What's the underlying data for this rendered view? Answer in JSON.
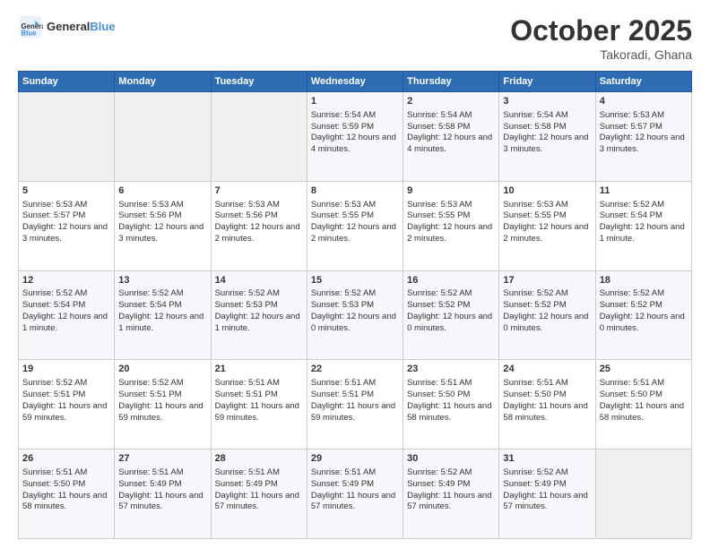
{
  "header": {
    "logo_text_general": "General",
    "logo_text_blue": "Blue",
    "month": "October 2025",
    "location": "Takoradi, Ghana"
  },
  "weekdays": [
    "Sunday",
    "Monday",
    "Tuesday",
    "Wednesday",
    "Thursday",
    "Friday",
    "Saturday"
  ],
  "weeks": [
    [
      {
        "day": "",
        "empty": true
      },
      {
        "day": "",
        "empty": true
      },
      {
        "day": "",
        "empty": true
      },
      {
        "day": "1",
        "sunrise": "Sunrise: 5:54 AM",
        "sunset": "Sunset: 5:59 PM",
        "daylight": "Daylight: 12 hours and 4 minutes."
      },
      {
        "day": "2",
        "sunrise": "Sunrise: 5:54 AM",
        "sunset": "Sunset: 5:58 PM",
        "daylight": "Daylight: 12 hours and 4 minutes."
      },
      {
        "day": "3",
        "sunrise": "Sunrise: 5:54 AM",
        "sunset": "Sunset: 5:58 PM",
        "daylight": "Daylight: 12 hours and 3 minutes."
      },
      {
        "day": "4",
        "sunrise": "Sunrise: 5:53 AM",
        "sunset": "Sunset: 5:57 PM",
        "daylight": "Daylight: 12 hours and 3 minutes."
      }
    ],
    [
      {
        "day": "5",
        "sunrise": "Sunrise: 5:53 AM",
        "sunset": "Sunset: 5:57 PM",
        "daylight": "Daylight: 12 hours and 3 minutes."
      },
      {
        "day": "6",
        "sunrise": "Sunrise: 5:53 AM",
        "sunset": "Sunset: 5:56 PM",
        "daylight": "Daylight: 12 hours and 3 minutes."
      },
      {
        "day": "7",
        "sunrise": "Sunrise: 5:53 AM",
        "sunset": "Sunset: 5:56 PM",
        "daylight": "Daylight: 12 hours and 2 minutes."
      },
      {
        "day": "8",
        "sunrise": "Sunrise: 5:53 AM",
        "sunset": "Sunset: 5:55 PM",
        "daylight": "Daylight: 12 hours and 2 minutes."
      },
      {
        "day": "9",
        "sunrise": "Sunrise: 5:53 AM",
        "sunset": "Sunset: 5:55 PM",
        "daylight": "Daylight: 12 hours and 2 minutes."
      },
      {
        "day": "10",
        "sunrise": "Sunrise: 5:53 AM",
        "sunset": "Sunset: 5:55 PM",
        "daylight": "Daylight: 12 hours and 2 minutes."
      },
      {
        "day": "11",
        "sunrise": "Sunrise: 5:52 AM",
        "sunset": "Sunset: 5:54 PM",
        "daylight": "Daylight: 12 hours and 1 minute."
      }
    ],
    [
      {
        "day": "12",
        "sunrise": "Sunrise: 5:52 AM",
        "sunset": "Sunset: 5:54 PM",
        "daylight": "Daylight: 12 hours and 1 minute."
      },
      {
        "day": "13",
        "sunrise": "Sunrise: 5:52 AM",
        "sunset": "Sunset: 5:54 PM",
        "daylight": "Daylight: 12 hours and 1 minute."
      },
      {
        "day": "14",
        "sunrise": "Sunrise: 5:52 AM",
        "sunset": "Sunset: 5:53 PM",
        "daylight": "Daylight: 12 hours and 1 minute."
      },
      {
        "day": "15",
        "sunrise": "Sunrise: 5:52 AM",
        "sunset": "Sunset: 5:53 PM",
        "daylight": "Daylight: 12 hours and 0 minutes."
      },
      {
        "day": "16",
        "sunrise": "Sunrise: 5:52 AM",
        "sunset": "Sunset: 5:52 PM",
        "daylight": "Daylight: 12 hours and 0 minutes."
      },
      {
        "day": "17",
        "sunrise": "Sunrise: 5:52 AM",
        "sunset": "Sunset: 5:52 PM",
        "daylight": "Daylight: 12 hours and 0 minutes."
      },
      {
        "day": "18",
        "sunrise": "Sunrise: 5:52 AM",
        "sunset": "Sunset: 5:52 PM",
        "daylight": "Daylight: 12 hours and 0 minutes."
      }
    ],
    [
      {
        "day": "19",
        "sunrise": "Sunrise: 5:52 AM",
        "sunset": "Sunset: 5:51 PM",
        "daylight": "Daylight: 11 hours and 59 minutes."
      },
      {
        "day": "20",
        "sunrise": "Sunrise: 5:52 AM",
        "sunset": "Sunset: 5:51 PM",
        "daylight": "Daylight: 11 hours and 59 minutes."
      },
      {
        "day": "21",
        "sunrise": "Sunrise: 5:51 AM",
        "sunset": "Sunset: 5:51 PM",
        "daylight": "Daylight: 11 hours and 59 minutes."
      },
      {
        "day": "22",
        "sunrise": "Sunrise: 5:51 AM",
        "sunset": "Sunset: 5:51 PM",
        "daylight": "Daylight: 11 hours and 59 minutes."
      },
      {
        "day": "23",
        "sunrise": "Sunrise: 5:51 AM",
        "sunset": "Sunset: 5:50 PM",
        "daylight": "Daylight: 11 hours and 58 minutes."
      },
      {
        "day": "24",
        "sunrise": "Sunrise: 5:51 AM",
        "sunset": "Sunset: 5:50 PM",
        "daylight": "Daylight: 11 hours and 58 minutes."
      },
      {
        "day": "25",
        "sunrise": "Sunrise: 5:51 AM",
        "sunset": "Sunset: 5:50 PM",
        "daylight": "Daylight: 11 hours and 58 minutes."
      }
    ],
    [
      {
        "day": "26",
        "sunrise": "Sunrise: 5:51 AM",
        "sunset": "Sunset: 5:50 PM",
        "daylight": "Daylight: 11 hours and 58 minutes."
      },
      {
        "day": "27",
        "sunrise": "Sunrise: 5:51 AM",
        "sunset": "Sunset: 5:49 PM",
        "daylight": "Daylight: 11 hours and 57 minutes."
      },
      {
        "day": "28",
        "sunrise": "Sunrise: 5:51 AM",
        "sunset": "Sunset: 5:49 PM",
        "daylight": "Daylight: 11 hours and 57 minutes."
      },
      {
        "day": "29",
        "sunrise": "Sunrise: 5:51 AM",
        "sunset": "Sunset: 5:49 PM",
        "daylight": "Daylight: 11 hours and 57 minutes."
      },
      {
        "day": "30",
        "sunrise": "Sunrise: 5:52 AM",
        "sunset": "Sunset: 5:49 PM",
        "daylight": "Daylight: 11 hours and 57 minutes."
      },
      {
        "day": "31",
        "sunrise": "Sunrise: 5:52 AM",
        "sunset": "Sunset: 5:49 PM",
        "daylight": "Daylight: 11 hours and 57 minutes."
      },
      {
        "day": "",
        "empty": true
      }
    ]
  ]
}
